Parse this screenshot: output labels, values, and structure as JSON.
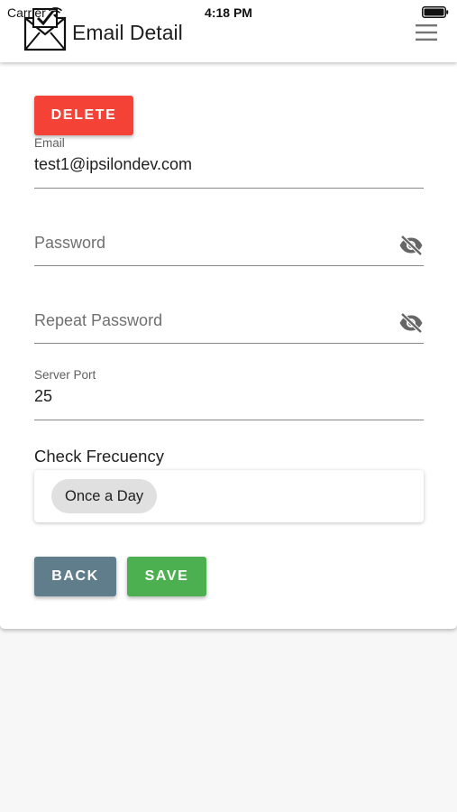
{
  "status_bar": {
    "carrier": "Carrier",
    "time": "4:18 PM"
  },
  "app_bar": {
    "title": "Email Detail",
    "logo_icon": "envelope-check-icon",
    "menu_icon": "hamburger-menu-icon"
  },
  "form": {
    "delete_label": "DELETE",
    "email": {
      "label": "Email",
      "value": "test1@ipsilondev.com"
    },
    "password": {
      "placeholder": "Password",
      "toggle_icon": "eye-off-icon"
    },
    "repeat_password": {
      "placeholder": "Repeat Password",
      "toggle_icon": "eye-off-icon"
    },
    "server_port": {
      "label": "Server Port",
      "value": "25"
    },
    "check_frequency": {
      "label": "Check Frecuency",
      "selected": "Once a Day"
    },
    "back_label": "BACK",
    "save_label": "SAVE"
  },
  "colors": {
    "delete": "#f44336",
    "back": "#607d8b",
    "save": "#4caf50",
    "chip": "#e0e0e0"
  }
}
